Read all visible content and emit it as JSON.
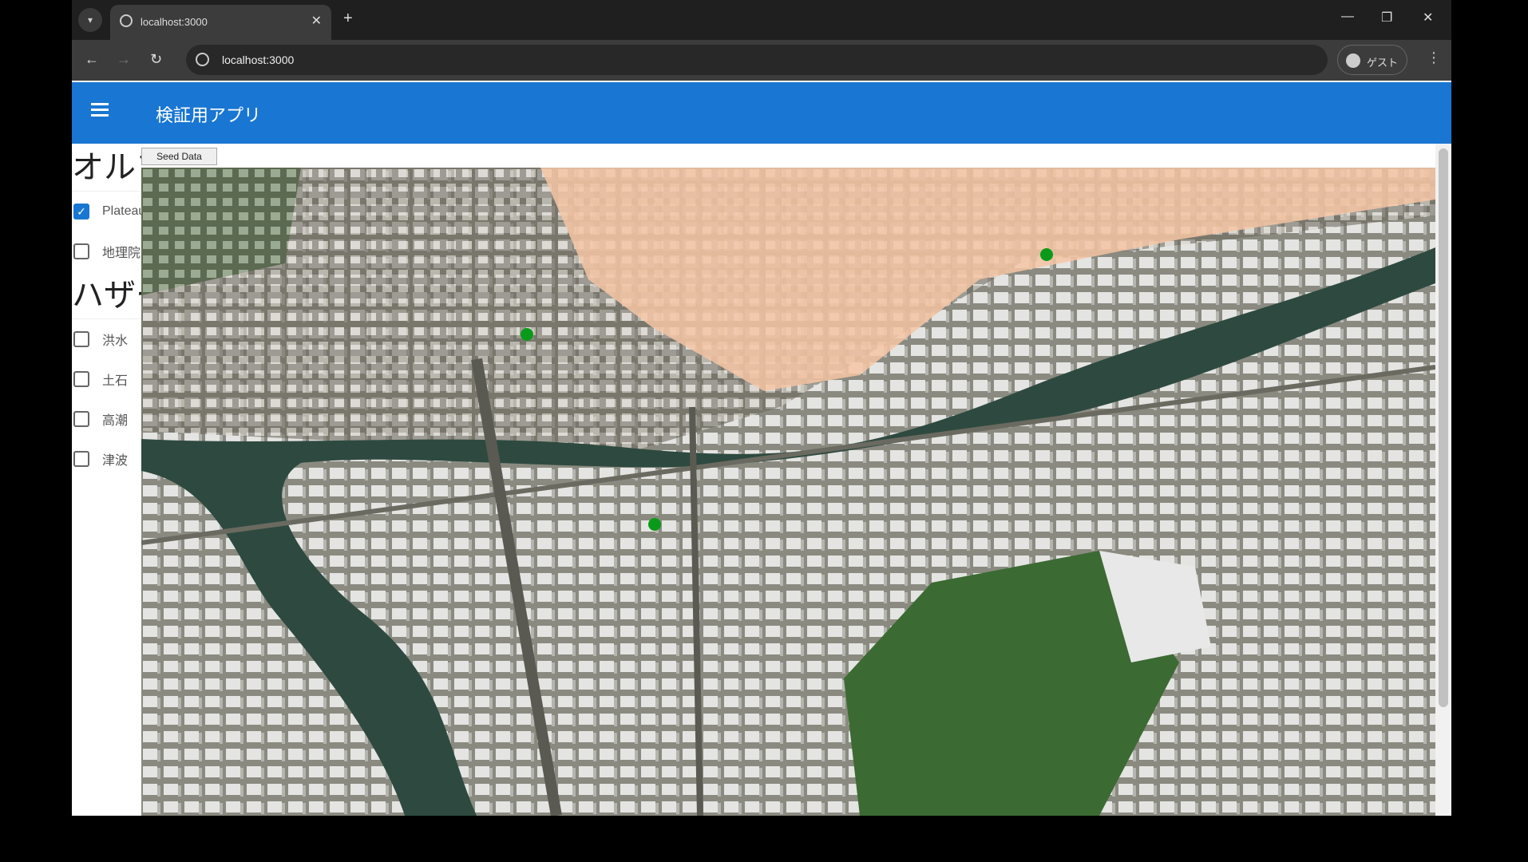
{
  "browser": {
    "tab_title": "localhost:3000",
    "url": "localhost:3000",
    "profile_label": "ゲスト"
  },
  "app": {
    "title": "検証用アプリ",
    "seed_button": "Seed Data"
  },
  "sidebar": {
    "sections": [
      {
        "title": "オルソ",
        "items": [
          {
            "label": "Plateau",
            "checked": true
          },
          {
            "label": "地理院",
            "checked": false
          }
        ]
      },
      {
        "title": "ハザード",
        "items": [
          {
            "label": "洪水",
            "checked": false
          },
          {
            "label": "土石",
            "checked": false
          },
          {
            "label": "高潮",
            "checked": false
          },
          {
            "label": "津波",
            "checked": false
          }
        ]
      }
    ]
  },
  "colors": {
    "appbar": "#1976d2",
    "marker": "#0a9a1a",
    "hazard_area": "#f6c6a4"
  }
}
